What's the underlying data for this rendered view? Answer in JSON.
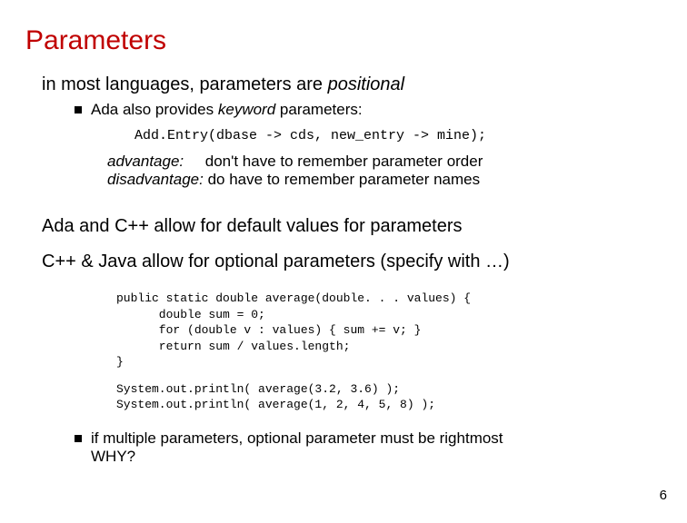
{
  "title": "Parameters",
  "line_intro_pre": "in most languages, parameters are ",
  "line_intro_italic": "positional",
  "bullet1_pre": "Ada also provides ",
  "bullet1_italic": "keyword",
  "bullet1_post": " parameters:",
  "code1": "Add.Entry(dbase -> cds, new_entry -> mine);",
  "adv_label": "advantage:",
  "adv_text": "     don't have to remember parameter order",
  "disadv_label": "disadvantage:",
  "disadv_text": " do have to remember parameter names",
  "section2": "Ada and C++ allow for default values for parameters",
  "section3": "C++ & Java allow for optional parameters (specify with …)",
  "code2": "public static double average(double. . . values) {\n      double sum = 0;\n      for (double v : values) { sum += v; }\n      return sum / values.length;\n}",
  "code3": "System.out.println( average(3.2, 3.6) );\nSystem.out.println( average(1, 2, 4, 5, 8) );",
  "bullet2_line1": "if multiple parameters, optional parameter must be rightmost",
  "bullet2_line2": "WHY?",
  "page_number": "6"
}
